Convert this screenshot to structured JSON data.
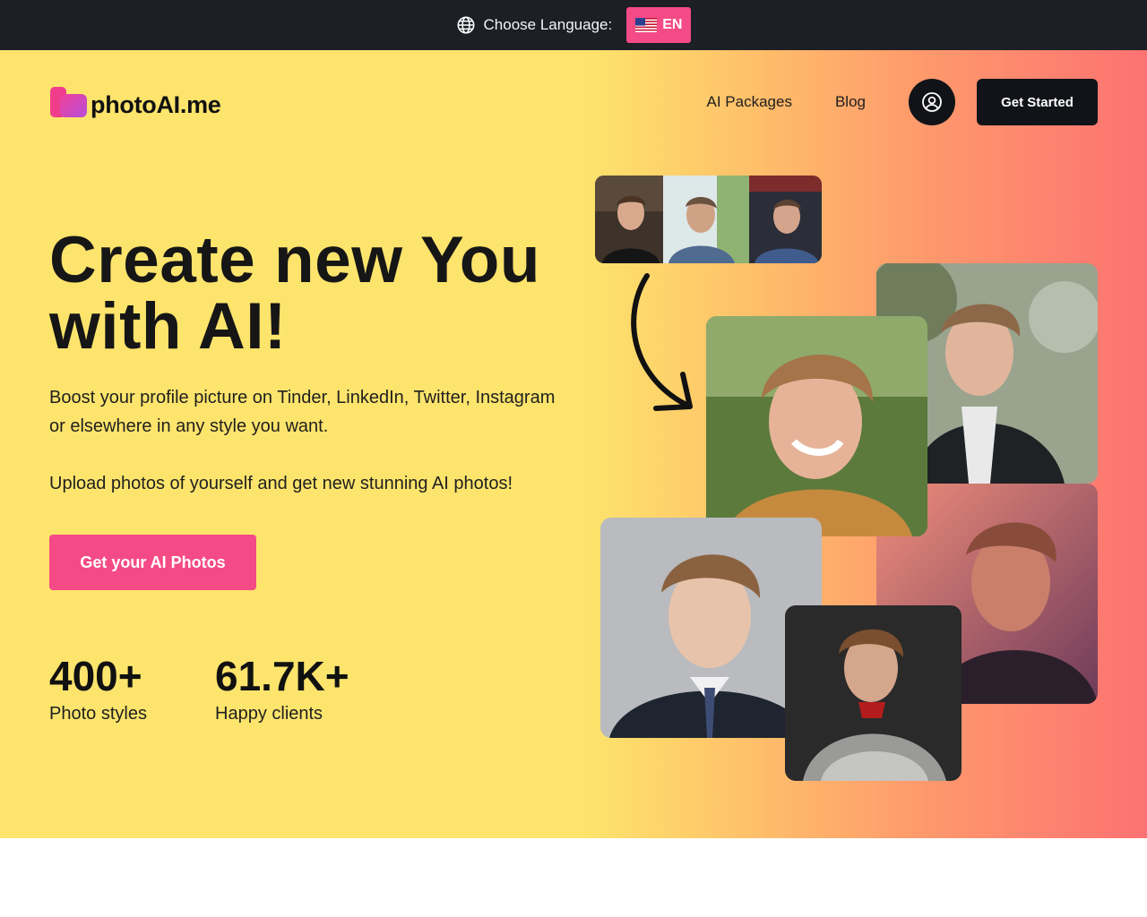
{
  "topbar": {
    "language_label": "Choose Language:",
    "language_code": "EN",
    "icon": "globe-icon"
  },
  "brand": {
    "name": "photoAI.me"
  },
  "nav": {
    "packages": "AI Packages",
    "blog": "Blog",
    "account_icon": "user-circle-icon",
    "cta": "Get Started"
  },
  "hero": {
    "headline_line1": "Create new You",
    "headline_line2": "with AI!",
    "sub1": "Boost your profile picture on Tinder, LinkedIn, Twitter, Instagram or elsewhere in any style you want.",
    "sub2": "Upload photos of yourself and get new stunning AI photos!",
    "cta": "Get your AI Photos"
  },
  "stats": [
    {
      "value": "400+",
      "label": "Photo styles"
    },
    {
      "value": "61.7K+",
      "label": "Happy clients"
    }
  ],
  "colors": {
    "accent_pink": "#f44b86",
    "dark": "#111318",
    "hero_yellow": "#fde46c",
    "hero_coral": "#fd7272"
  }
}
